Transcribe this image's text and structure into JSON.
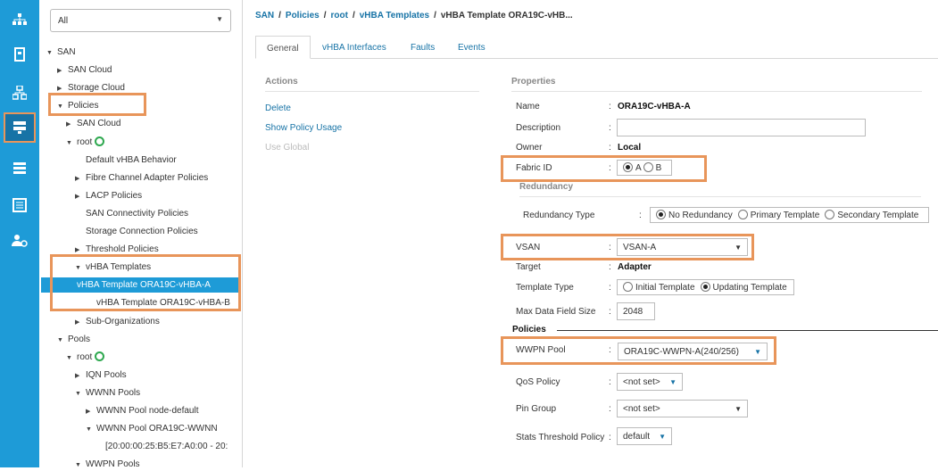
{
  "nav": {
    "icons": [
      "topology-icon",
      "device-icon",
      "network-icon",
      "storage-icon",
      "list-icon",
      "admin-icon",
      "user-settings-icon"
    ]
  },
  "tree": {
    "filter": "All",
    "nodes": [
      {
        "label": "SAN",
        "level": 0,
        "arrow": "open"
      },
      {
        "label": "SAN Cloud",
        "level": 1,
        "arrow": "closed"
      },
      {
        "label": "Storage Cloud",
        "level": 1,
        "arrow": "closed"
      },
      {
        "label": "Policies",
        "level": 1,
        "arrow": "open"
      },
      {
        "label": "SAN Cloud",
        "level": 2,
        "arrow": "closed"
      },
      {
        "label": "root",
        "level": 2,
        "arrow": "open"
      },
      {
        "label": "Default vHBA Behavior",
        "level": 3,
        "arrow": ""
      },
      {
        "label": "Fibre Channel Adapter Policies",
        "level": 3,
        "arrow": "closed"
      },
      {
        "label": "LACP Policies",
        "level": 3,
        "arrow": "closed"
      },
      {
        "label": "SAN Connectivity Policies",
        "level": 3,
        "arrow": ""
      },
      {
        "label": "Storage Connection Policies",
        "level": 3,
        "arrow": ""
      },
      {
        "label": "Threshold Policies",
        "level": 3,
        "arrow": "closed"
      },
      {
        "label": "vHBA Templates",
        "level": 3,
        "arrow": "open"
      },
      {
        "label": "vHBA Template ORA19C-vHBA-A",
        "level": 4,
        "arrow": ""
      },
      {
        "label": "vHBA Template ORA19C-vHBA-B",
        "level": 4,
        "arrow": ""
      },
      {
        "label": "Sub-Organizations",
        "level": 3,
        "arrow": "closed"
      },
      {
        "label": "Pools",
        "level": 1,
        "arrow": "open"
      },
      {
        "label": "root",
        "level": 2,
        "arrow": "open"
      },
      {
        "label": "IQN Pools",
        "level": 3,
        "arrow": "closed"
      },
      {
        "label": "WWNN Pools",
        "level": 3,
        "arrow": "open"
      },
      {
        "label": "WWNN Pool node-default",
        "level": 4,
        "arrow": "closed"
      },
      {
        "label": "WWNN Pool ORA19C-WWNN",
        "level": 4,
        "arrow": "open"
      },
      {
        "label": "[20:00:00:25:B5:E7:A0:00 - 20:",
        "level": 5,
        "arrow": ""
      },
      {
        "label": "WWPN Pools",
        "level": 3,
        "arrow": "open"
      }
    ]
  },
  "breadcrumb": {
    "items": [
      "SAN",
      "Policies",
      "root",
      "vHBA Templates"
    ],
    "sep": "/",
    "current": "vHBA Template ORA19C-vHB..."
  },
  "tabs": [
    "General",
    "vHBA Interfaces",
    "Faults",
    "Events"
  ],
  "actions": {
    "title": "Actions",
    "items": [
      "Delete",
      "Show Policy Usage",
      "Use Global"
    ]
  },
  "properties": {
    "title": "Properties",
    "name_label": "Name",
    "name_value": "ORA19C-vHBA-A",
    "description_label": "Description",
    "description_value": "",
    "owner_label": "Owner",
    "owner_value": "Local",
    "fabric_label": "Fabric ID",
    "fabric_options": [
      "A",
      "B"
    ],
    "fabric_selected": "A",
    "redundancy_title": "Redundancy",
    "redundancy_type_label": "Redundancy Type",
    "redundancy_options": [
      "No Redundancy",
      "Primary Template",
      "Secondary Template"
    ],
    "redundancy_selected": "No Redundancy",
    "vsan_label": "VSAN",
    "vsan_value": "VSAN-A",
    "target_label": "Target",
    "target_value": "Adapter",
    "template_type_label": "Template Type",
    "template_options": [
      "Initial Template",
      "Updating Template"
    ],
    "template_selected": "Updating Template",
    "max_field_label": "Max Data Field Size",
    "max_field_value": "2048",
    "policies_title": "Policies",
    "wwpn_label": "WWPN Pool",
    "wwpn_value": "ORA19C-WWPN-A(240/256)",
    "qos_label": "QoS Policy",
    "qos_value": "<not set>",
    "pin_label": "Pin Group",
    "pin_value": "<not set>",
    "stats_label": "Stats Threshold Policy",
    "stats_value": "default"
  },
  "colors": {
    "accent": "#1e9bd7",
    "highlight": "#e8955a",
    "link": "#1773a6"
  }
}
